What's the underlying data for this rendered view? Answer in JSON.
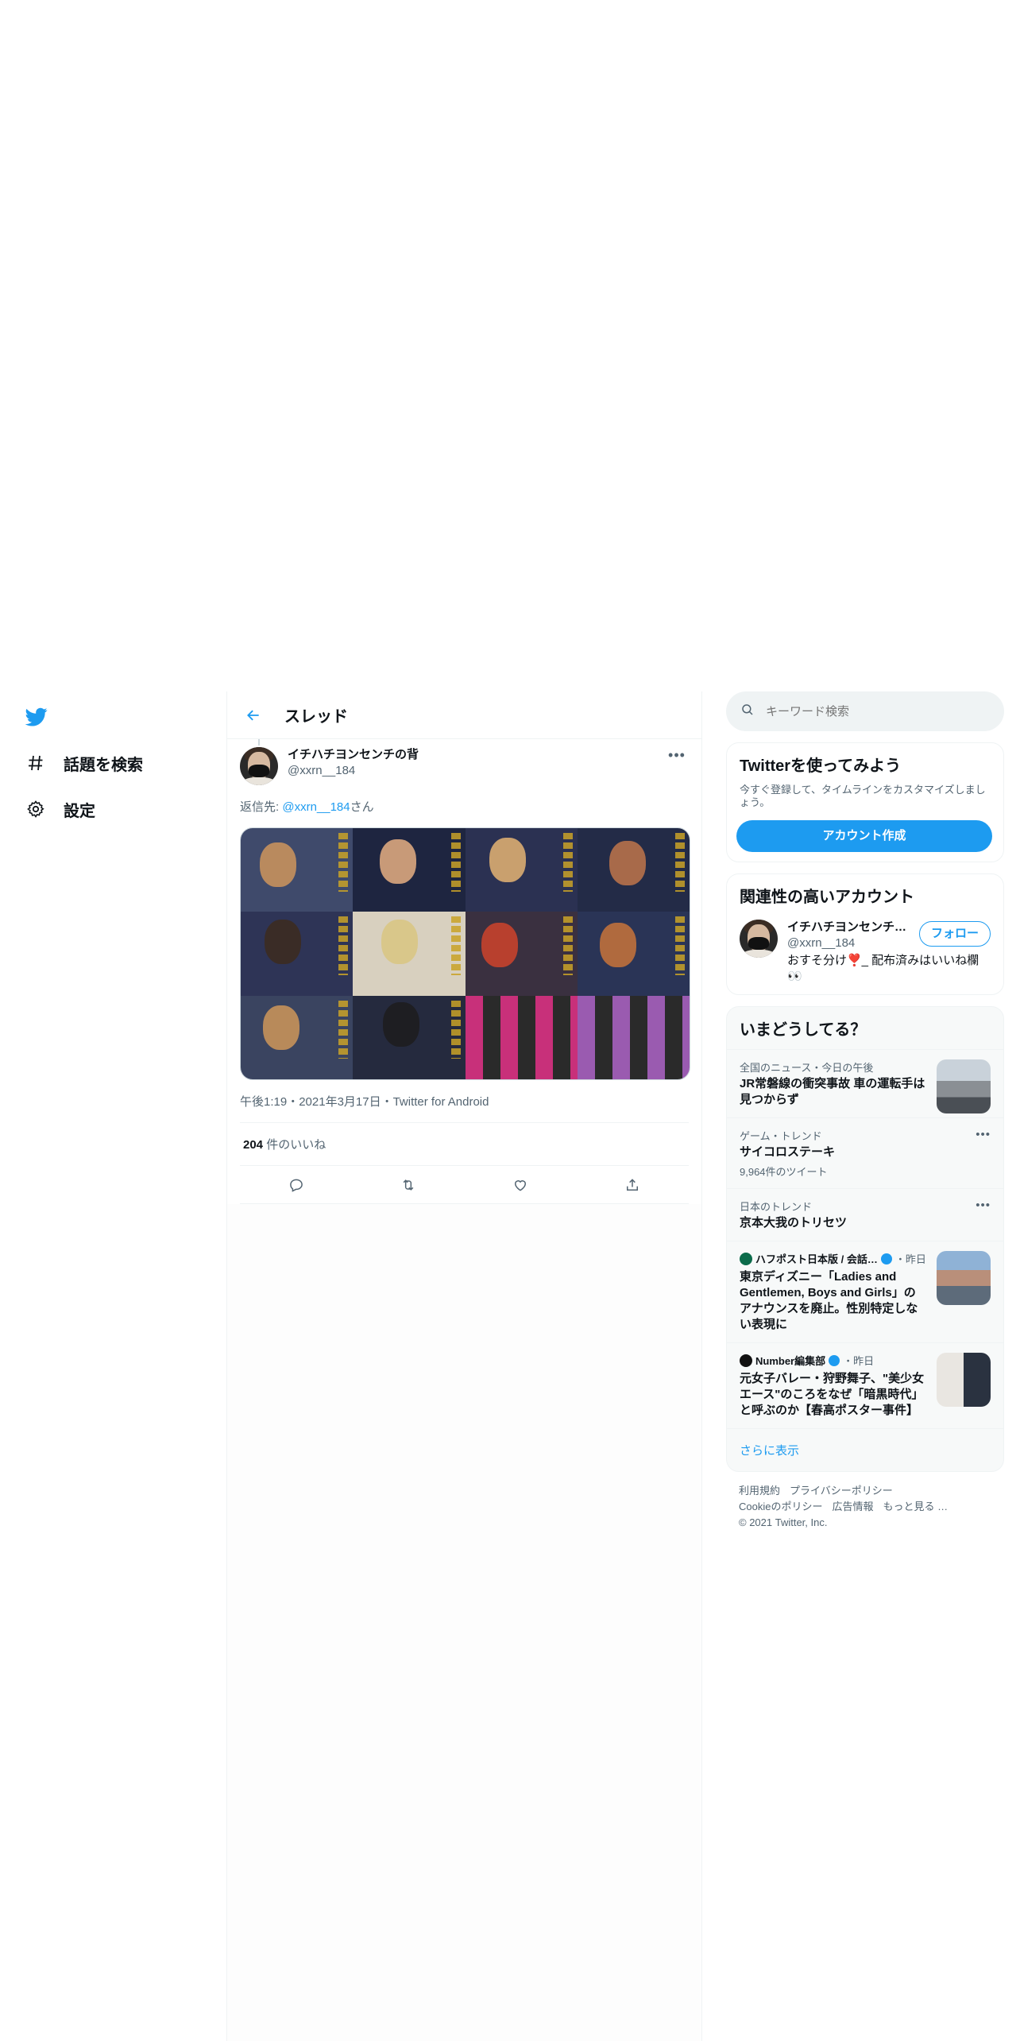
{
  "nav": {
    "items": [
      {
        "label": "話題を検索",
        "icon": "hashtag-icon"
      },
      {
        "label": "設定",
        "icon": "gear-icon"
      }
    ]
  },
  "header": {
    "title": "スレッド"
  },
  "tweet": {
    "display_name": "イチハチヨンセンチの背",
    "handle": "@xxrn__184",
    "reply_prefix": "返信先: ",
    "reply_mention": "@xxrn__184",
    "reply_suffix": "さん",
    "timestamp": "午後1:19・2021年3月17日・Twitter for Android",
    "likes_count": "204",
    "likes_label": " 件のいいね"
  },
  "search": {
    "placeholder": "キーワード検索"
  },
  "signup": {
    "title": "Twitterを使ってみよう",
    "subtitle": "今すぐ登録して、タイムラインをカスタマイズしましょう。",
    "button": "アカウント作成"
  },
  "related": {
    "title": "関連性の高いアカウント",
    "account": {
      "display_name": "イチハチヨンセンチ…",
      "handle": "@xxrn__184",
      "bio": "おすそ分け❣️_ 配布済みはいいね欄👀",
      "follow_label": "フォロー"
    }
  },
  "trends": {
    "title": "いまどうしてる？",
    "items": [
      {
        "context": "全国のニュース・今日の午後",
        "title": "JR常磐線の衝突事故 車の運転手は見つからず"
      },
      {
        "context": "ゲーム・トレンド",
        "title": "サイコロステーキ",
        "count": "9,964件のツイート"
      },
      {
        "context": "日本のトレンド",
        "title": "京本大我のトリセツ"
      },
      {
        "source": "ハフポスト日本版 / 会話…",
        "time": "・昨日",
        "title": "東京ディズニー「Ladies and Gentlemen, Boys and Girls」のアナウンスを廃止。性別特定しない表現に"
      },
      {
        "source": "Number編集部",
        "time": "・昨日",
        "title": "元女子バレー・狩野舞子、\"美少女エース\"のころをなぜ「暗黒時代」と呼ぶのか【春高ポスター事件】"
      }
    ],
    "show_more": "さらに表示"
  },
  "footer": {
    "links": [
      "利用規約",
      "プライバシーポリシー",
      "Cookieのポリシー",
      "広告情報",
      "もっと見る …"
    ],
    "copyright": "© 2021 Twitter, Inc."
  },
  "colors": {
    "accent": "#1d9bf0",
    "text": "#0f1419",
    "muted": "#536471",
    "border": "#eff3f4"
  }
}
